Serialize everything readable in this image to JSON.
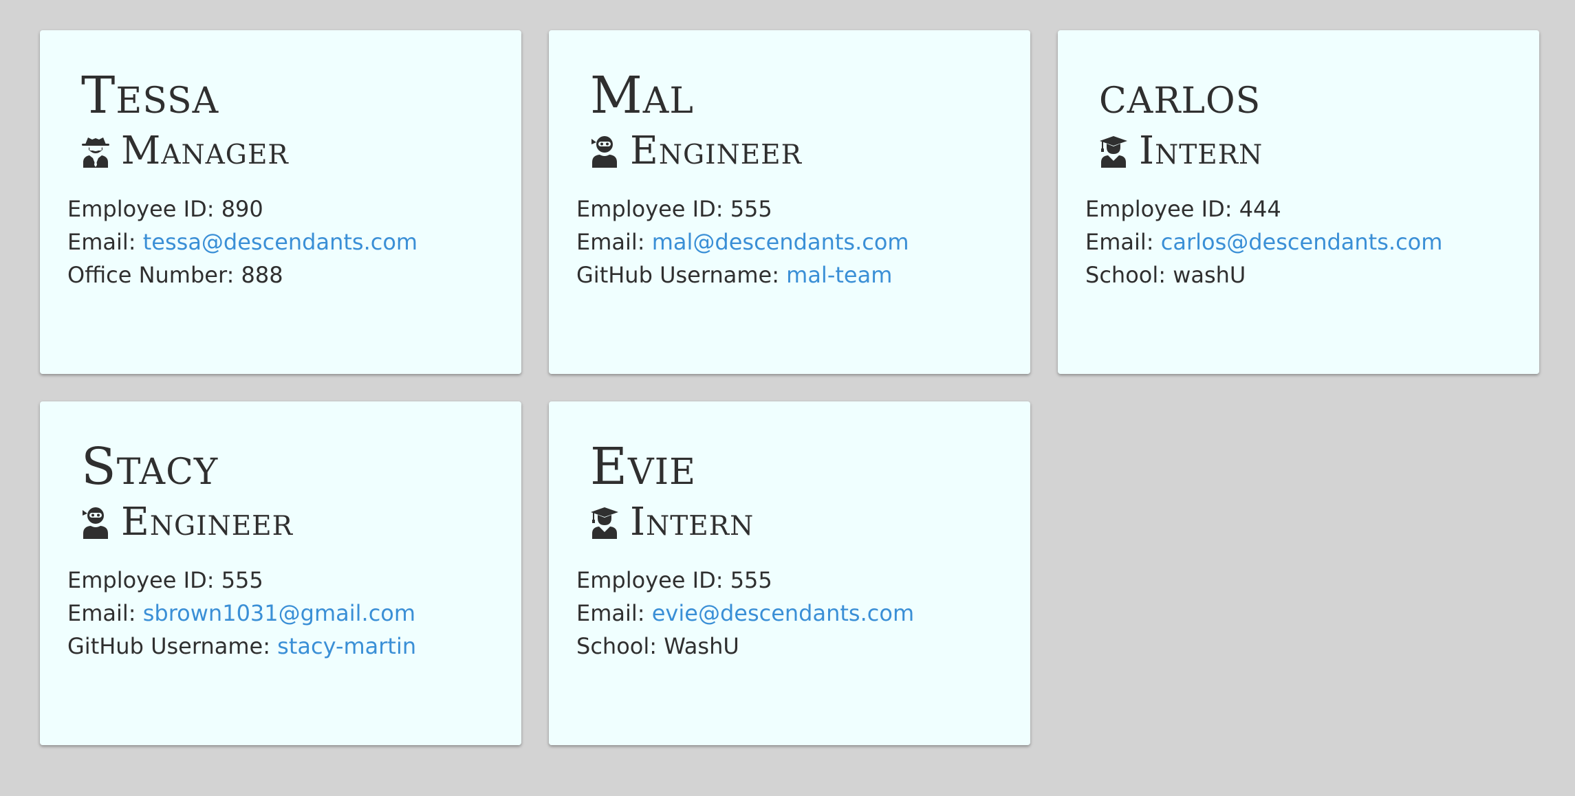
{
  "theme": {
    "page_bg": "#d3d3d3",
    "card_bg": "#f0ffff",
    "text_color": "#2f2f2f",
    "link_color": "#3a8fd6"
  },
  "cards": [
    {
      "name": "Tessa",
      "role": "Manager",
      "role_icon": "user-secret-icon",
      "id_label": "Employee ID: ",
      "id_value": "890",
      "email_label": "Email: ",
      "email": "tessa@descendants.com",
      "extra_label": "Office Number: ",
      "extra_value": "888"
    },
    {
      "name": "Mal",
      "role": "Engineer",
      "role_icon": "user-ninja-icon",
      "id_label": "Employee ID: ",
      "id_value": "555",
      "email_label": "Email: ",
      "email": "mal@descendants.com",
      "extra_label": "GitHub Username: ",
      "extra_value": "mal-team"
    },
    {
      "name": "carlos",
      "role": "Intern",
      "role_icon": "user-graduate-icon",
      "id_label": "Employee ID: ",
      "id_value": "444",
      "email_label": "Email: ",
      "email": "carlos@descendants.com",
      "extra_label": "School: ",
      "extra_value": "washU"
    },
    {
      "name": "Stacy",
      "role": "Engineer",
      "role_icon": "user-ninja-icon",
      "id_label": "Employee ID: ",
      "id_value": "555",
      "email_label": "Email: ",
      "email": "sbrown1031@gmail.com",
      "extra_label": "GitHub Username: ",
      "extra_value": "stacy-martin"
    },
    {
      "name": "Evie",
      "role": "Intern",
      "role_icon": "user-graduate-icon",
      "id_label": "Employee ID: ",
      "id_value": "555",
      "email_label": "Email: ",
      "email": "evie@descendants.com",
      "extra_label": "School: ",
      "extra_value": "WashU"
    }
  ]
}
